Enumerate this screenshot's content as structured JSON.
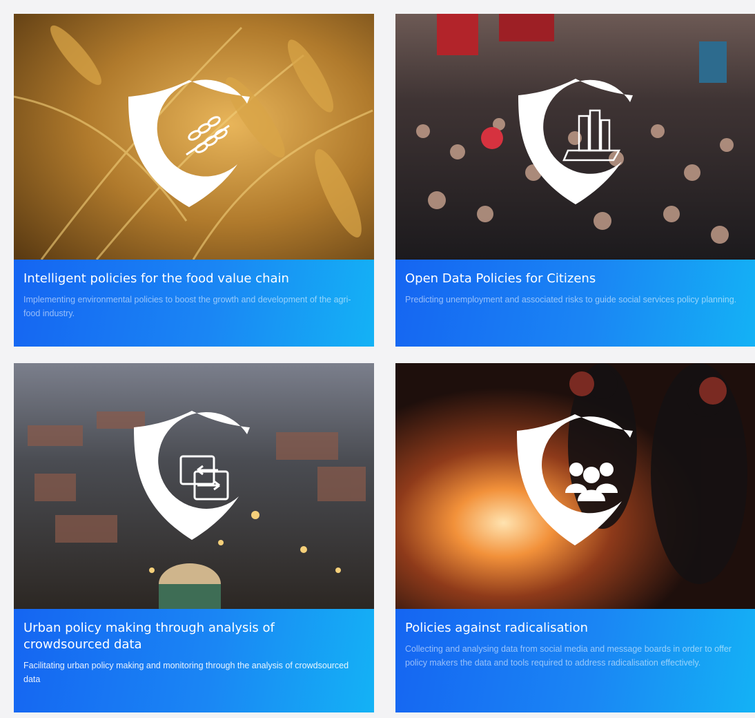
{
  "cards": [
    {
      "title": "Intelligent policies for the food value chain",
      "description": "Implementing environmental policies to boost the growth and development of the agri-food industry.",
      "image": "wheat-field-photo",
      "icon": "wheat-icon"
    },
    {
      "title": "Open Data Policies for Citizens",
      "description": "Predicting unemployment and associated risks to guide social services policy planning.",
      "image": "crowd-street-photo",
      "icon": "city-buildings-icon"
    },
    {
      "title": "Urban policy making through analysis of crowdsourced data",
      "description": "Facilitating urban policy making and monitoring through the analysis of crowdsourced data",
      "image": "city-aerial-night-photo",
      "icon": "exchange-arrows-icon"
    },
    {
      "title": "Policies against radicalisation",
      "description": "Collecting and analysing data from social media and message boards in order to offer policy makers the data and tools required to address radicalisation effectively.",
      "image": "riot-fire-photo",
      "icon": "group-people-icon"
    }
  ],
  "colors": {
    "caption_gradient_start": "#1565f2",
    "caption_gradient_end": "#14b2f5",
    "page_background": "#f3f3f5",
    "shield": "#ffffff"
  }
}
